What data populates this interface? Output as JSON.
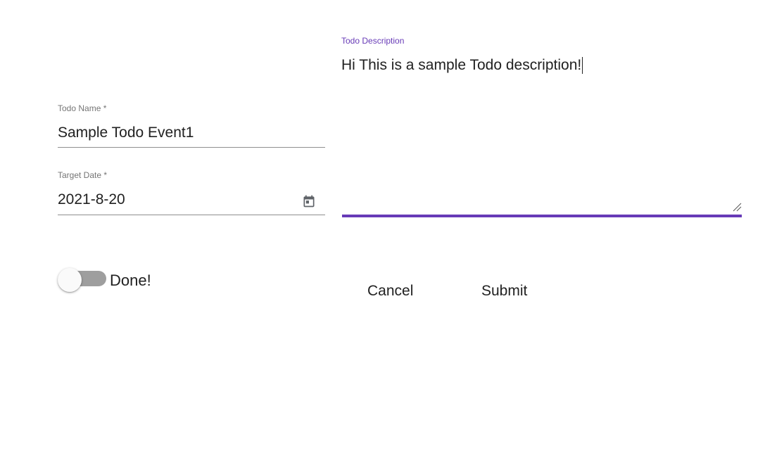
{
  "form": {
    "todo_name": {
      "label": "Todo Name *",
      "value": "Sample Todo Event1"
    },
    "target_date": {
      "label": "Target Date *",
      "value": "2021-8-20",
      "icon": "calendar-icon"
    },
    "todo_description": {
      "label": "Todo Description",
      "value": "Hi This is a sample Todo description!",
      "focused": true
    },
    "done_toggle": {
      "label": "Done!",
      "checked": false
    },
    "actions": {
      "cancel_label": "Cancel",
      "submit_label": "Submit"
    }
  },
  "colors": {
    "accent": "#673ab7",
    "label": "#757575",
    "text": "#212121",
    "switch_track": "#9e9e9e"
  }
}
